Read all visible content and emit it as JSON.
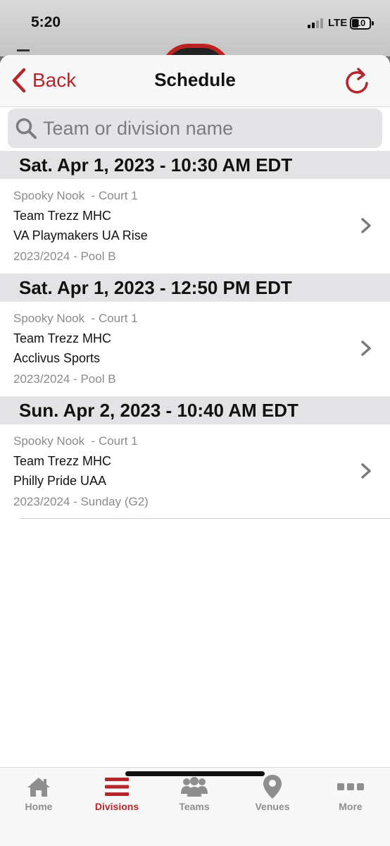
{
  "status": {
    "time": "5:20",
    "network": "LTE",
    "battery": "10"
  },
  "nav": {
    "back_label": "Back",
    "title": "Schedule"
  },
  "search": {
    "placeholder": "Team or division name",
    "value": ""
  },
  "schedule": [
    {
      "date": "Sat. Apr 1, 2023 - 10:30 AM EDT",
      "games": [
        {
          "venue": "Spooky Nook  - Court 1",
          "team1": "Team Trezz MHC",
          "team2": "VA Playmakers UA Rise",
          "division": "2023/2024 - Pool B"
        }
      ]
    },
    {
      "date": "Sat. Apr 1, 2023 - 12:50 PM EDT",
      "games": [
        {
          "venue": "Spooky Nook  - Court 1",
          "team1": "Team Trezz MHC",
          "team2": "Acclivus Sports",
          "division": "2023/2024 - Pool B"
        }
      ]
    },
    {
      "date": "Sun. Apr 2, 2023 - 10:40 AM EDT",
      "games": [
        {
          "venue": "Spooky Nook  - Court 1",
          "team1": "Team Trezz MHC",
          "team2": "Philly Pride UAA",
          "division": "2023/2024 - Sunday (G2)"
        }
      ]
    }
  ],
  "tabs": [
    {
      "label": "Home",
      "icon": "house-icon",
      "active": false
    },
    {
      "label": "Divisions",
      "icon": "list-icon",
      "active": true
    },
    {
      "label": "Teams",
      "icon": "people-icon",
      "active": false
    },
    {
      "label": "Venues",
      "icon": "map-pin-icon",
      "active": false
    },
    {
      "label": "More",
      "icon": "more-dots-icon",
      "active": false
    }
  ],
  "colors": {
    "accent": "#b3262a",
    "inactive": "#8e8e8e",
    "header_bg": "#e3e3e6"
  }
}
